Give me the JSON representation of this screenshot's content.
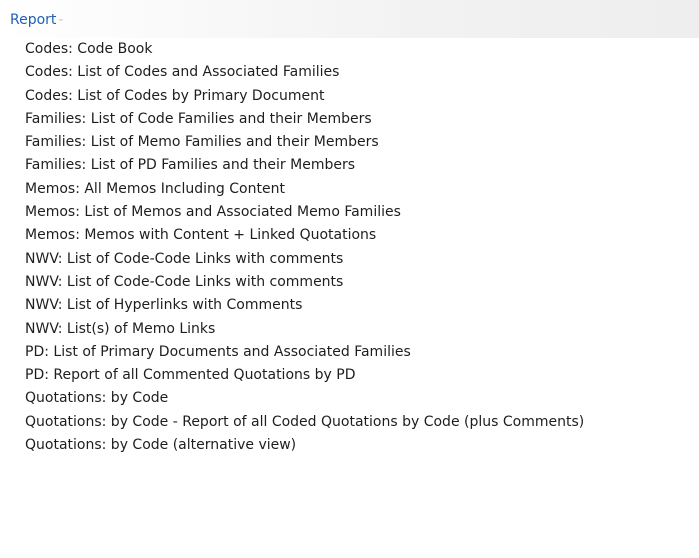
{
  "menu": {
    "title": "Report",
    "title_suffix": "-",
    "items": [
      {
        "label": "Codes: Code Book"
      },
      {
        "label": "Codes: List of Codes and Associated Families"
      },
      {
        "label": "Codes: List of Codes by Primary Document"
      },
      {
        "label": "Families: List of Code Families and their Members"
      },
      {
        "label": "Families: List of Memo Families and their Members"
      },
      {
        "label": "Families: List of PD Families and their Members"
      },
      {
        "label": "Memos: All Memos Including Content"
      },
      {
        "label": "Memos: List of Memos and Associated Memo Families"
      },
      {
        "label": "Memos: Memos with Content + Linked Quotations"
      },
      {
        "label": "NWV: List of Code-Code Links with comments"
      },
      {
        "label": "NWV: List of Code-Code Links with comments"
      },
      {
        "label": "NWV: List of Hyperlinks with Comments"
      },
      {
        "label": "NWV: List(s) of Memo Links"
      },
      {
        "label": "PD: List of Primary Documents and Associated Families"
      },
      {
        "label": "PD: Report of all Commented Quotations by PD"
      },
      {
        "label": "Quotations: by Code"
      },
      {
        "label": "Quotations: by Code - Report of all Coded Quotations by Code (plus Comments)"
      },
      {
        "label": "Quotations: by Code (alternative view)"
      }
    ]
  },
  "colors": {
    "title": "#1f5fb8",
    "text": "#1e1e1e",
    "background": "#ffffff"
  }
}
